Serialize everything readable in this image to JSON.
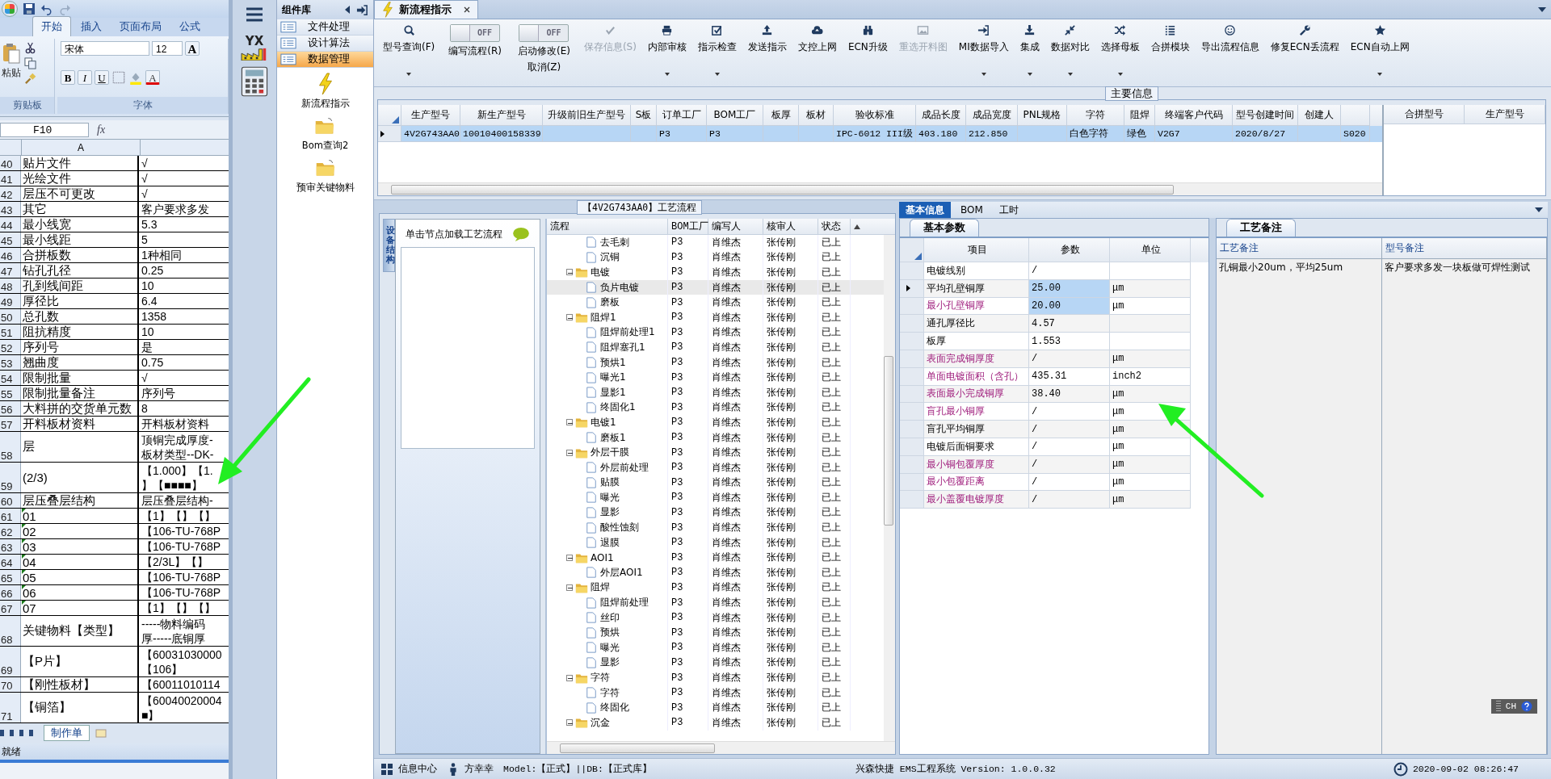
{
  "excel": {
    "ribbon_tabs": [
      {
        "label": "开始",
        "selected": true
      },
      {
        "label": "插入",
        "selected": false
      },
      {
        "label": "页面布局",
        "selected": false
      },
      {
        "label": "公式",
        "selected": false
      }
    ],
    "paste_label": "粘贴",
    "clipboard_group": "剪贴板",
    "font_name": "宋体",
    "font_size": "12",
    "grow_key": "A",
    "bold_key": "B",
    "italic_key": "I",
    "underline_key": "U",
    "color_key": "A",
    "font_group": "字体",
    "name_box": "F10",
    "fx": "fx",
    "column_header": "A",
    "rows": [
      {
        "num": "40",
        "a": "贴片文件",
        "b": [
          "√"
        ],
        "marked": false
      },
      {
        "num": "41",
        "a": "光绘文件",
        "b": [
          "√"
        ],
        "marked": false
      },
      {
        "num": "42",
        "a": "层压不可更改",
        "b": [
          "√"
        ],
        "marked": false
      },
      {
        "num": "43",
        "a": "其它",
        "b": [
          "客户要求多发"
        ],
        "marked": false
      },
      {
        "num": "44",
        "a": "最小线宽",
        "b": [
          "5.3"
        ],
        "marked": false
      },
      {
        "num": "45",
        "a": "最小线距",
        "b": [
          "5"
        ],
        "marked": false
      },
      {
        "num": "46",
        "a": "合拼板数",
        "b": [
          "1种相同"
        ],
        "marked": false
      },
      {
        "num": "47",
        "a": "钻孔孔径",
        "b": [
          "0.25"
        ],
        "marked": false
      },
      {
        "num": "48",
        "a": "孔到线间距",
        "b": [
          "10"
        ],
        "marked": false
      },
      {
        "num": "49",
        "a": "厚径比",
        "b": [
          "6.4"
        ],
        "marked": false
      },
      {
        "num": "50",
        "a": "总孔数",
        "b": [
          "1358"
        ],
        "marked": false
      },
      {
        "num": "51",
        "a": "阻抗精度",
        "b": [
          "10"
        ],
        "marked": false
      },
      {
        "num": "52",
        "a": "序列号",
        "b": [
          "是"
        ],
        "marked": false
      },
      {
        "num": "53",
        "a": "翘曲度",
        "b": [
          "0.75"
        ],
        "marked": false
      },
      {
        "num": "54",
        "a": "限制批量",
        "b": [
          "√"
        ],
        "marked": false
      },
      {
        "num": "55",
        "a": "限制批量备注",
        "b": [
          "序列号"
        ],
        "marked": false
      },
      {
        "num": "56",
        "a": "大料拼的交货单元数",
        "b": [
          "8"
        ],
        "marked": false
      },
      {
        "num": "57",
        "a": "开料板材资料",
        "b": [
          "开料板材资料"
        ],
        "marked": false
      },
      {
        "num": "58",
        "a": "层",
        "b": [
          "顶铜完成厚度-",
          "板材类型--DK-"
        ],
        "marked": false
      },
      {
        "num": "59",
        "a": "(2/3)",
        "b": [
          "【1.000】【1.",
          "】【■■■■】"
        ],
        "marked": false
      },
      {
        "num": "60",
        "a": "层压叠层结构",
        "b": [
          "层压叠层结构-"
        ],
        "marked": false
      },
      {
        "num": "61",
        "a": "01",
        "b": [
          "【1】【】【】"
        ],
        "marked": true
      },
      {
        "num": "62",
        "a": "02",
        "b": [
          "【106-TU-768P"
        ],
        "marked": true
      },
      {
        "num": "63",
        "a": "03",
        "b": [
          "【106-TU-768P"
        ],
        "marked": true
      },
      {
        "num": "64",
        "a": "04",
        "b": [
          "【2/3L】【】"
        ],
        "marked": true
      },
      {
        "num": "65",
        "a": "05",
        "b": [
          "【106-TU-768P"
        ],
        "marked": true
      },
      {
        "num": "66",
        "a": "06",
        "b": [
          "【106-TU-768P"
        ],
        "marked": true
      },
      {
        "num": "67",
        "a": "07",
        "b": [
          "【1】【】【】"
        ],
        "marked": true
      },
      {
        "num": "68",
        "a": "关键物料【类型】",
        "b": [
          "-----物料编码",
          "厚-----底铜厚"
        ],
        "marked": false
      },
      {
        "num": "69",
        "a": "【P片】",
        "b": [
          "【60031030000",
          "【106】"
        ],
        "marked": false
      },
      {
        "num": "70",
        "a": "【刚性板材】",
        "b": [
          "【60011010114"
        ],
        "marked": false
      },
      {
        "num": "71",
        "a": "【铜箔】",
        "b": [
          "【60040020004",
          "■】"
        ],
        "marked": false
      }
    ],
    "sheet_tab": "制作单",
    "status": "就绪"
  },
  "nav": {
    "logo_text": "YX"
  },
  "library": {
    "title": "组件库",
    "categories": [
      {
        "label": "文件处理",
        "selected": false
      },
      {
        "label": "设计算法",
        "selected": false
      },
      {
        "label": "数据管理",
        "selected": true
      }
    ],
    "tools": [
      {
        "kind": "bolt",
        "label": "新流程指示"
      },
      {
        "kind": "folder",
        "label": "Bom查询2"
      },
      {
        "kind": "folder",
        "label": "预审关键物料"
      }
    ]
  },
  "tabs": [
    {
      "label": "新流程指示",
      "selected": true
    }
  ],
  "toolbar": [
    {
      "kind": "button",
      "label": "型号查询(F)",
      "dropdown": true,
      "disabled": false
    },
    {
      "kind": "toggle",
      "switch_text": "OFF",
      "on": false,
      "label": "编写流程(R)"
    },
    {
      "kind": "toggle",
      "switch_text": "OFF",
      "on": false,
      "label": "启动修改(E)",
      "sub_label": "取消(Z)"
    },
    {
      "kind": "button",
      "label": "保存信息(S)",
      "dropdown": false,
      "disabled": true
    },
    {
      "kind": "button",
      "label": "内部审核",
      "dropdown": true,
      "disabled": false
    },
    {
      "kind": "button",
      "label": "指示检查",
      "dropdown": true,
      "disabled": false
    },
    {
      "kind": "button",
      "label": "发送指示",
      "dropdown": false,
      "disabled": false
    },
    {
      "kind": "button",
      "label": "文控上网",
      "dropdown": false,
      "disabled": false
    },
    {
      "kind": "button",
      "label": "ECN升级",
      "dropdown": false,
      "disabled": false
    },
    {
      "kind": "button",
      "label": "重选开料图",
      "dropdown": false,
      "disabled": true
    },
    {
      "kind": "button",
      "label": "MI数据导入",
      "dropdown": true,
      "disabled": false
    },
    {
      "kind": "button",
      "label": "集成",
      "dropdown": true,
      "disabled": false
    },
    {
      "kind": "button",
      "label": "数据对比",
      "dropdown": true,
      "disabled": false
    },
    {
      "kind": "button",
      "label": "选择母板",
      "dropdown": true,
      "disabled": false
    },
    {
      "kind": "button",
      "label": "合拼模块",
      "dropdown": false,
      "disabled": false
    },
    {
      "kind": "button",
      "label": "导出流程信息",
      "dropdown": false,
      "disabled": false
    },
    {
      "kind": "button",
      "label": "修复ECN丢流程",
      "dropdown": false,
      "disabled": false
    },
    {
      "kind": "button",
      "label": "ECN自动上网",
      "dropdown": true,
      "disabled": false
    }
  ],
  "main_info": {
    "title": "主要信息",
    "columns": [
      "生产型号",
      "新生产型号",
      "升级前旧生产型号",
      "S板",
      "订单工厂",
      "BOM工厂",
      "板厚",
      "板材",
      "验收标准",
      "成品长度",
      "成品宽度",
      "PNL规格",
      "字符",
      "阻焊",
      "终端客户代码",
      "型号创建时间",
      "创建人",
      null
    ],
    "rows": [
      {
        "selected": true,
        "cells": [
          "4V2G743AA0",
          "10010400158339",
          null,
          null,
          "P3",
          "P3",
          null,
          null,
          "IPC-6012 III级",
          "403.180",
          "212.850",
          null,
          "白色字符",
          "绿色",
          "V2G7",
          "2020/8/27",
          null,
          "S020"
        ]
      }
    ],
    "side_columns": [
      "合拼型号",
      "生产型号"
    ]
  },
  "process": {
    "title": "【4V2G743AA0】工艺流程",
    "side_tab": "设备结构",
    "hint": "单击节点加载工艺流程",
    "columns": [
      "流程",
      "BOM工厂",
      "编写人",
      "核审人",
      "状态"
    ],
    "continued": [
      {
        "label": "去毛刺",
        "bom": "P3",
        "writer": "肖维杰",
        "reviewer": "张传刚",
        "status": "已上",
        "selected": false
      },
      {
        "label": "沉铜",
        "bom": "P3",
        "writer": "肖维杰",
        "reviewer": "张传刚",
        "status": "已上",
        "selected": false
      }
    ],
    "nodes": [
      {
        "label": "电镀",
        "bom": "P3",
        "writer": "肖维杰",
        "reviewer": "张传刚",
        "status": "已上",
        "selected": false,
        "expanded": true,
        "children": [
          {
            "label": "负片电镀",
            "bom": "P3",
            "writer": "肖维杰",
            "reviewer": "张传刚",
            "status": "已上",
            "selected": true
          },
          {
            "label": "磨板",
            "bom": "P3",
            "writer": "肖维杰",
            "reviewer": "张传刚",
            "status": "已上",
            "selected": false
          }
        ]
      },
      {
        "label": "阻焊1",
        "bom": "P3",
        "writer": "肖维杰",
        "reviewer": "张传刚",
        "status": "已上",
        "selected": false,
        "expanded": true,
        "children": [
          {
            "label": "阻焊前处理1",
            "bom": "P3",
            "writer": "肖维杰",
            "reviewer": "张传刚",
            "status": "已上",
            "selected": false
          },
          {
            "label": "阻焊塞孔1",
            "bom": "P3",
            "writer": "肖维杰",
            "reviewer": "张传刚",
            "status": "已上",
            "selected": false
          },
          {
            "label": "预烘1",
            "bom": "P3",
            "writer": "肖维杰",
            "reviewer": "张传刚",
            "status": "已上",
            "selected": false
          },
          {
            "label": "曝光1",
            "bom": "P3",
            "writer": "肖维杰",
            "reviewer": "张传刚",
            "status": "已上",
            "selected": false
          },
          {
            "label": "显影1",
            "bom": "P3",
            "writer": "肖维杰",
            "reviewer": "张传刚",
            "status": "已上",
            "selected": false
          },
          {
            "label": "终固化1",
            "bom": "P3",
            "writer": "肖维杰",
            "reviewer": "张传刚",
            "status": "已上",
            "selected": false
          }
        ]
      },
      {
        "label": "电镀1",
        "bom": "P3",
        "writer": "肖维杰",
        "reviewer": "张传刚",
        "status": "已上",
        "selected": false,
        "expanded": true,
        "children": [
          {
            "label": "磨板1",
            "bom": "P3",
            "writer": "肖维杰",
            "reviewer": "张传刚",
            "status": "已上",
            "selected": false
          }
        ]
      },
      {
        "label": "外层干膜",
        "bom": "P3",
        "writer": "肖维杰",
        "reviewer": "张传刚",
        "status": "已上",
        "selected": false,
        "expanded": true,
        "children": [
          {
            "label": "外层前处理",
            "bom": "P3",
            "writer": "肖维杰",
            "reviewer": "张传刚",
            "status": "已上",
            "selected": false
          },
          {
            "label": "贴膜",
            "bom": "P3",
            "writer": "肖维杰",
            "reviewer": "张传刚",
            "status": "已上",
            "selected": false
          },
          {
            "label": "曝光",
            "bom": "P3",
            "writer": "肖维杰",
            "reviewer": "张传刚",
            "status": "已上",
            "selected": false
          },
          {
            "label": "显影",
            "bom": "P3",
            "writer": "肖维杰",
            "reviewer": "张传刚",
            "status": "已上",
            "selected": false
          },
          {
            "label": "酸性蚀刻",
            "bom": "P3",
            "writer": "肖维杰",
            "reviewer": "张传刚",
            "status": "已上",
            "selected": false
          },
          {
            "label": "退膜",
            "bom": "P3",
            "writer": "肖维杰",
            "reviewer": "张传刚",
            "status": "已上",
            "selected": false
          }
        ]
      },
      {
        "label": "AOI1",
        "bom": "P3",
        "writer": "肖维杰",
        "reviewer": "张传刚",
        "status": "已上",
        "selected": false,
        "expanded": true,
        "children": [
          {
            "label": "外层AOI1",
            "bom": "P3",
            "writer": "肖维杰",
            "reviewer": "张传刚",
            "status": "已上",
            "selected": false
          }
        ]
      },
      {
        "label": "阻焊",
        "bom": "P3",
        "writer": "肖维杰",
        "reviewer": "张传刚",
        "status": "已上",
        "selected": false,
        "expanded": true,
        "children": [
          {
            "label": "阻焊前处理",
            "bom": "P3",
            "writer": "肖维杰",
            "reviewer": "张传刚",
            "status": "已上",
            "selected": false
          },
          {
            "label": "丝印",
            "bom": "P3",
            "writer": "肖维杰",
            "reviewer": "张传刚",
            "status": "已上",
            "selected": false
          },
          {
            "label": "预烘",
            "bom": "P3",
            "writer": "肖维杰",
            "reviewer": "张传刚",
            "status": "已上",
            "selected": false
          },
          {
            "label": "曝光",
            "bom": "P3",
            "writer": "肖维杰",
            "reviewer": "张传刚",
            "status": "已上",
            "selected": false
          },
          {
            "label": "显影",
            "bom": "P3",
            "writer": "肖维杰",
            "reviewer": "张传刚",
            "status": "已上",
            "selected": false
          }
        ]
      },
      {
        "label": "字符",
        "bom": "P3",
        "writer": "肖维杰",
        "reviewer": "张传刚",
        "status": "已上",
        "selected": false,
        "expanded": true,
        "children": [
          {
            "label": "字符",
            "bom": "P3",
            "writer": "肖维杰",
            "reviewer": "张传刚",
            "status": "已上",
            "selected": false
          },
          {
            "label": "终固化",
            "bom": "P3",
            "writer": "肖维杰",
            "reviewer": "张传刚",
            "status": "已上",
            "selected": false
          }
        ]
      },
      {
        "label": "沉金",
        "bom": "P3",
        "writer": "肖维杰",
        "reviewer": "张传刚",
        "status": "已上",
        "selected": false,
        "expanded": true
      }
    ]
  },
  "detail": {
    "tabs": [
      {
        "label": "基本信息",
        "selected": true
      },
      {
        "label": "BOM",
        "selected": false
      },
      {
        "label": "工时",
        "selected": false
      }
    ],
    "params_tab": "基本参数",
    "columns": [
      "项目",
      "参数",
      "单位"
    ],
    "params": [
      {
        "item": "电镀线别",
        "value": "/",
        "selected": false,
        "value_selected": false,
        "required": false
      },
      {
        "item": "平均孔壁铜厚",
        "value": "25.00",
        "unit": "μm",
        "selected": true,
        "value_selected": true,
        "required": false
      },
      {
        "item": "最小孔壁铜厚",
        "value": "20.00",
        "unit": "μm",
        "selected": false,
        "value_selected": true,
        "required": true
      },
      {
        "item": "通孔厚径比",
        "value": "4.57",
        "selected": false,
        "value_selected": false,
        "required": false
      },
      {
        "item": "板厚",
        "value": "1.553",
        "selected": false,
        "value_selected": false,
        "required": false
      },
      {
        "item": "表面完成铜厚度",
        "value": "/",
        "unit": "μm",
        "selected": false,
        "value_selected": false,
        "required": true
      },
      {
        "item": "单面电镀面积（含孔）",
        "value": "435.31",
        "unit": "inch2",
        "selected": false,
        "value_selected": false,
        "required": true
      },
      {
        "item": "表面最小完成铜厚",
        "value": "38.40",
        "unit": "μm",
        "selected": false,
        "value_selected": false,
        "required": true
      },
      {
        "item": "盲孔最小铜厚",
        "value": "/",
        "unit": "μm",
        "selected": false,
        "value_selected": false,
        "required": true
      },
      {
        "item": "盲孔平均铜厚",
        "value": "/",
        "unit": "μm",
        "selected": false,
        "value_selected": false,
        "required": false
      },
      {
        "item": "电镀后面铜要求",
        "value": "/",
        "unit": "μm",
        "selected": false,
        "value_selected": false,
        "required": false
      },
      {
        "item": "最小铜包覆厚度",
        "value": "/",
        "unit": "μm",
        "selected": false,
        "value_selected": false,
        "required": true
      },
      {
        "item": "最小包覆距离",
        "value": "/",
        "unit": "μm",
        "selected": false,
        "value_selected": false,
        "required": true
      },
      {
        "item": "最小盖覆电镀厚度",
        "value": "/",
        "unit": "μm",
        "selected": false,
        "value_selected": false,
        "required": true
      }
    ],
    "remarks_tab": "工艺备注",
    "remark_columns": [
      "工艺备注",
      "型号备注"
    ],
    "remarks": [
      "孔铜最小20um，平均25um",
      "客户要求多发一块板做可焊性测试"
    ],
    "ime": "CH"
  },
  "status_bar": {
    "info_center": "信息中心",
    "user": "方幸幸",
    "model": "Model:【正式】||DB:【正式库】",
    "version": "兴森快捷 EMS工程系统 Version: 1.0.0.32",
    "datetime": "2020-09-02 08:26:47"
  }
}
